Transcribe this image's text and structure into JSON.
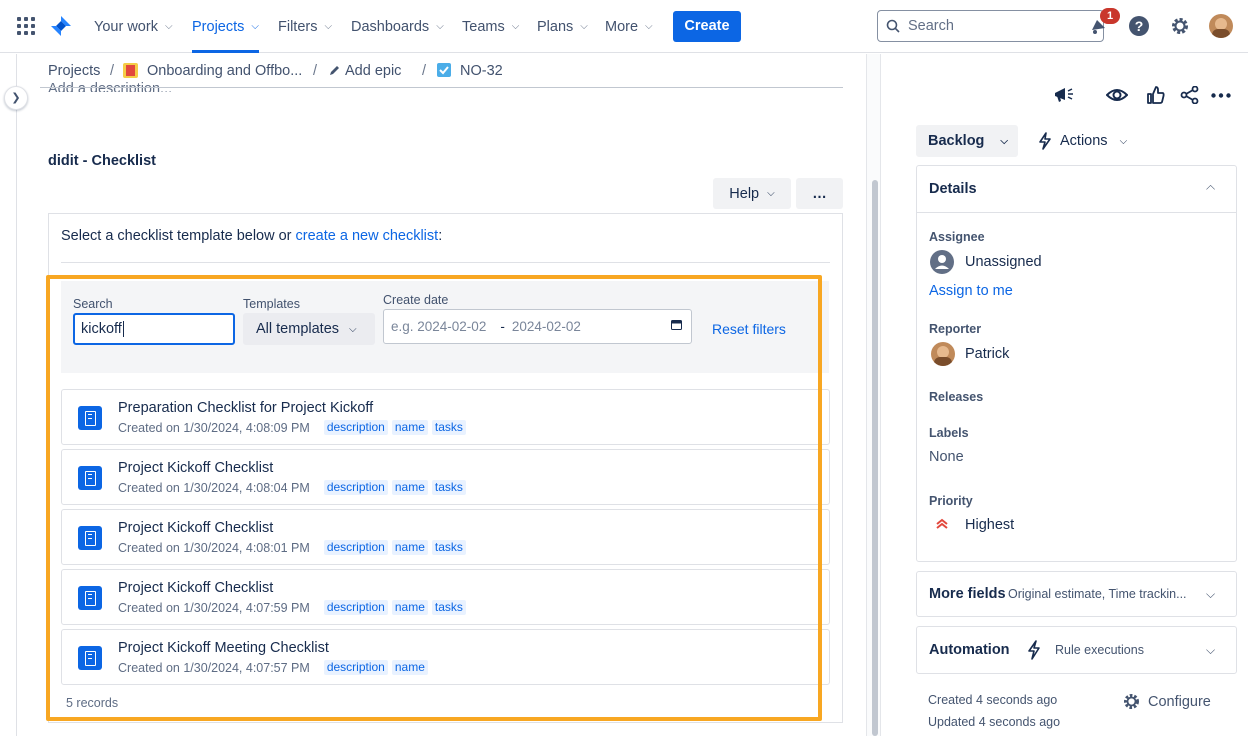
{
  "nav": {
    "your_work": "Your work",
    "projects": "Projects",
    "filters": "Filters",
    "dashboards": "Dashboards",
    "teams": "Teams",
    "plans": "Plans",
    "more": "More",
    "create": "Create",
    "search_placeholder": "Search",
    "notification_count": "1"
  },
  "breadcrumb": {
    "projects": "Projects",
    "project_name": "Onboarding and Offbo...",
    "add_epic": "Add epic",
    "issue_key": "NO-32"
  },
  "main": {
    "description_placeholder": "Add a description...",
    "section_title": "didit - Checklist",
    "help_label": "Help",
    "more_label": "…",
    "intro_text": "Select a checklist template below or ",
    "intro_link": "create a new checklist",
    "intro_suffix": ":",
    "filters": {
      "search_label": "Search",
      "search_value": "kickoff",
      "templates_label": "Templates",
      "templates_value": "All templates",
      "date_label": "Create date",
      "date_from_placeholder": "e.g. 2024-02-02",
      "date_separator": "-",
      "date_to_placeholder": "2024-02-02",
      "reset": "Reset filters"
    },
    "results": [
      {
        "title": "Preparation Checklist for Project Kickoff",
        "created": "Created on 1/30/2024, 4:08:09 PM",
        "tags": [
          "description",
          "name",
          "tasks"
        ]
      },
      {
        "title": "Project Kickoff Checklist",
        "created": "Created on 1/30/2024, 4:08:04 PM",
        "tags": [
          "description",
          "name",
          "tasks"
        ]
      },
      {
        "title": "Project Kickoff Checklist",
        "created": "Created on 1/30/2024, 4:08:01 PM",
        "tags": [
          "description",
          "name",
          "tasks"
        ]
      },
      {
        "title": "Project Kickoff Checklist",
        "created": "Created on 1/30/2024, 4:07:59 PM",
        "tags": [
          "description",
          "name",
          "tasks"
        ]
      },
      {
        "title": "Project Kickoff Meeting Checklist",
        "created": "Created on 1/30/2024, 4:07:57 PM",
        "tags": [
          "description",
          "name"
        ]
      }
    ],
    "records": "5 records"
  },
  "sidebar": {
    "status": "Backlog",
    "actions": "Actions",
    "details_title": "Details",
    "assignee_label": "Assignee",
    "assignee_value": "Unassigned",
    "assign_to_me": "Assign to me",
    "reporter_label": "Reporter",
    "reporter_value": "Patrick",
    "releases_label": "Releases",
    "labels_label": "Labels",
    "labels_value": "None",
    "priority_label": "Priority",
    "priority_value": "Highest",
    "more_fields_title": "More fields",
    "more_fields_sub": "Original estimate, Time trackin...",
    "automation_title": "Automation",
    "automation_sub": "Rule executions",
    "created": "Created 4 seconds ago",
    "updated": "Updated 4 seconds ago",
    "configure": "Configure"
  },
  "colors": {
    "accent": "#0c66e4",
    "highlight": "#f8a722",
    "priority": "#e2483d"
  }
}
